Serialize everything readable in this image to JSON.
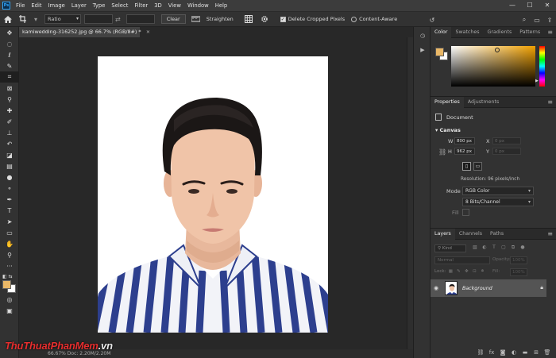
{
  "app": {
    "logo": "Ps",
    "menu": [
      "File",
      "Edit",
      "Image",
      "Layer",
      "Type",
      "Select",
      "Filter",
      "3D",
      "View",
      "Window",
      "Help"
    ],
    "window_controls": [
      "—",
      "☐",
      "✕"
    ]
  },
  "options_bar": {
    "ratio_label": "Ratio",
    "clear_label": "Clear",
    "straighten_label": "Straighten",
    "delete_cropped_label": "Delete Cropped Pixels",
    "delete_cropped_checked": true,
    "content_aware_label": "Content-Aware"
  },
  "document": {
    "tab_title": "kamiwedding-316252.jpg @ 66.7% (RGB/8#) *",
    "close_glyph": "×",
    "status_text": "66.67%   Doc: 2.20M/2.20M"
  },
  "panels": {
    "color_tabs": [
      "Color",
      "Swatches",
      "Gradients",
      "Patterns"
    ],
    "foreground_color": "#eab867",
    "background_color": "#ffffff",
    "properties_tabs": [
      "Properties",
      "Adjustments"
    ],
    "properties_type": "Document",
    "canvas_section": "Canvas",
    "width_label": "W",
    "width_value": "800 px",
    "height_label": "H",
    "height_value": "962 px",
    "x_label": "X",
    "x_placeholder": "0 px",
    "y_label": "Y",
    "y_placeholder": "0 px",
    "resolution": "Resolution: 96 pixels/inch",
    "mode_label": "Mode",
    "mode_value": "RGB Color",
    "depth_value": "8 Bits/Channel",
    "fill_label": "Fill",
    "layers_tabs": [
      "Layers",
      "Channels",
      "Paths"
    ],
    "layers_search_placeholder": "Kind",
    "blend_mode": "Normal",
    "opacity_label": "Opacity:",
    "opacity_value": "100%",
    "lock_label": "Lock:",
    "fill_opacity_label": "Fill:",
    "fill_opacity_value": "100%",
    "layer_name": "Background"
  },
  "watermark": {
    "part1": "Thu",
    "part2": "Thuat",
    "part3": "Phan",
    "part4": "Mem",
    "part5": ".vn"
  },
  "accent_color": "#31a8ff"
}
